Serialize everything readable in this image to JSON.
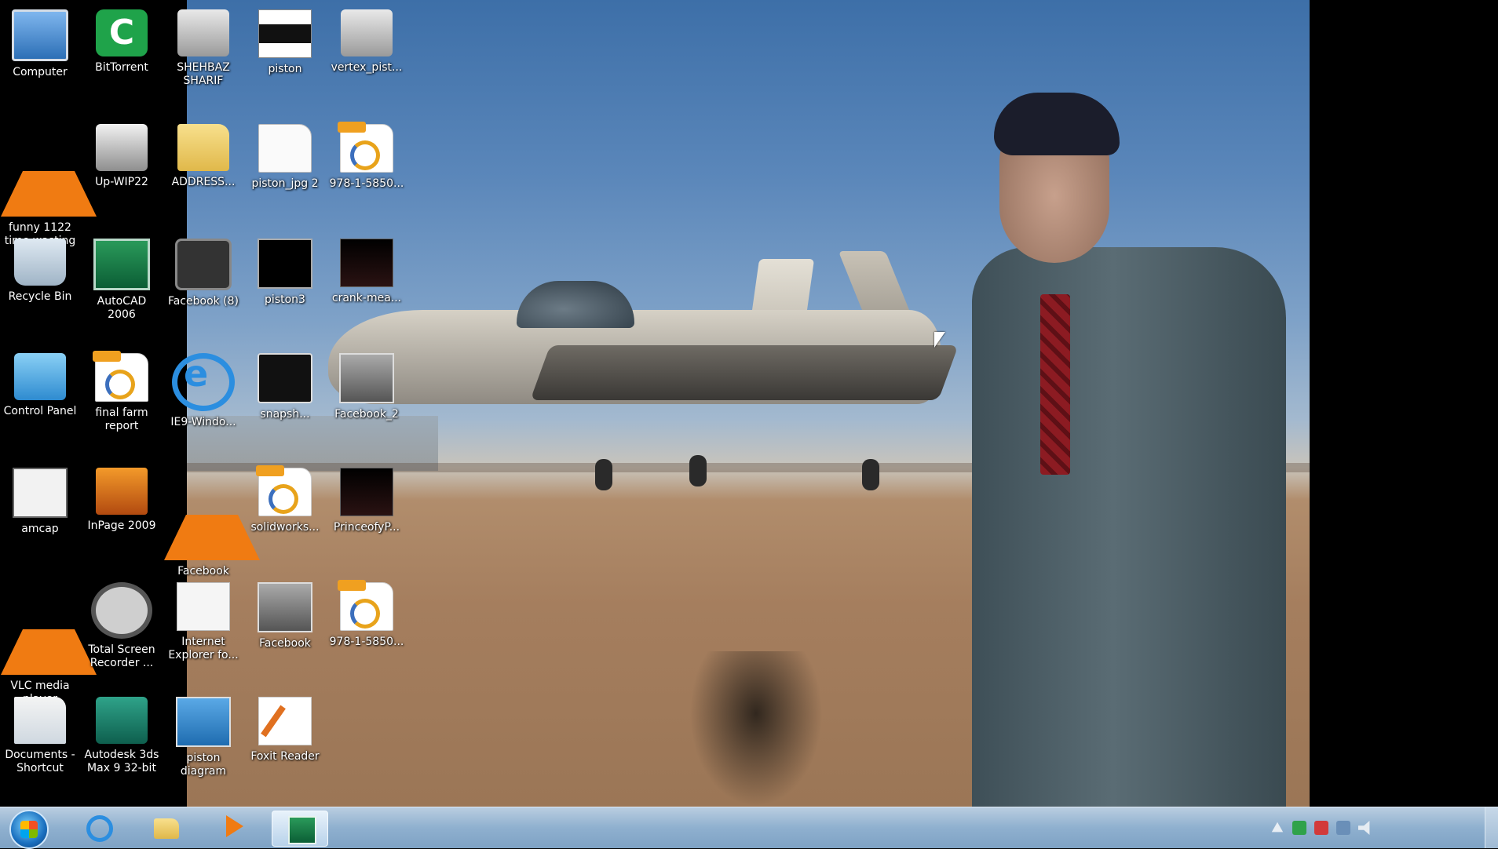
{
  "desktop": {
    "icons": [
      {
        "label": "Computer",
        "glyph": "monitor"
      },
      {
        "label": "BitTorrent",
        "glyph": "torrent"
      },
      {
        "label": "SHEHBAZ SHARIF",
        "glyph": "scanner"
      },
      {
        "label": "piston",
        "glyph": "piston"
      },
      {
        "label": "vertex_pist...",
        "glyph": "scanner"
      },
      {
        "label": "funny 1122 time wasting",
        "glyph": "vlc"
      },
      {
        "label": "Up-WIP22",
        "glyph": "hand"
      },
      {
        "label": "ADDRESS...",
        "glyph": "folder"
      },
      {
        "label": "piston_jpg 2",
        "glyph": "file"
      },
      {
        "label": "978-1-5850...",
        "glyph": "pdf"
      },
      {
        "label": "Recycle Bin",
        "glyph": "bin"
      },
      {
        "label": "AutoCAD 2006",
        "glyph": "acad"
      },
      {
        "label": "Facebook (8)",
        "glyph": "facebook-dl"
      },
      {
        "label": "piston3",
        "glyph": "black"
      },
      {
        "label": "crank-mea...",
        "glyph": "dark"
      },
      {
        "label": "Control Panel",
        "glyph": "ctrl"
      },
      {
        "label": "final farm report",
        "glyph": "pdf"
      },
      {
        "label": "IE9-Windo...",
        "glyph": "ie"
      },
      {
        "label": "snapsh...",
        "glyph": "cam"
      },
      {
        "label": "Facebook_2",
        "glyph": "thumb"
      },
      {
        "label": "amcap",
        "glyph": "cmd"
      },
      {
        "label": "InPage 2009",
        "glyph": "inpage"
      },
      {
        "label": "Facebook",
        "glyph": "vlc"
      },
      {
        "label": "solidworks...",
        "glyph": "pdf"
      },
      {
        "label": "PrinceofyP...",
        "glyph": "dark"
      },
      {
        "label": "VLC media player",
        "glyph": "vlc"
      },
      {
        "label": "Total Screen Recorder ...",
        "glyph": "reel"
      },
      {
        "label": "Internet Explorer fo...",
        "glyph": "ie2"
      },
      {
        "label": "Facebook",
        "glyph": "thumb"
      },
      {
        "label": "978-1-5850...",
        "glyph": "pdf"
      },
      {
        "label": "Documents - Shortcut",
        "glyph": "doc"
      },
      {
        "label": "Autodesk 3ds Max 9 32-bit",
        "glyph": "3ds"
      },
      {
        "label": "piston diagram",
        "glyph": "diagram"
      },
      {
        "label": "Foxit Reader",
        "glyph": "foxit"
      }
    ]
  },
  "taskbar": {
    "buttons": [
      {
        "name": "internet-explorer",
        "icon": "ie-icon"
      },
      {
        "name": "windows-explorer",
        "icon": "folder-icon"
      },
      {
        "name": "media-player",
        "icon": "media-play-icon"
      },
      {
        "name": "autocad",
        "icon": "autocad-icon"
      }
    ],
    "tray_icons": [
      "arrow-up-icon",
      "network-icon",
      "flag-icon",
      "display-icon",
      "speaker-icon"
    ]
  },
  "colors": {
    "taskbar": "#8fb0cf",
    "sky": "#5b87ba",
    "ground": "#a57e5e"
  }
}
